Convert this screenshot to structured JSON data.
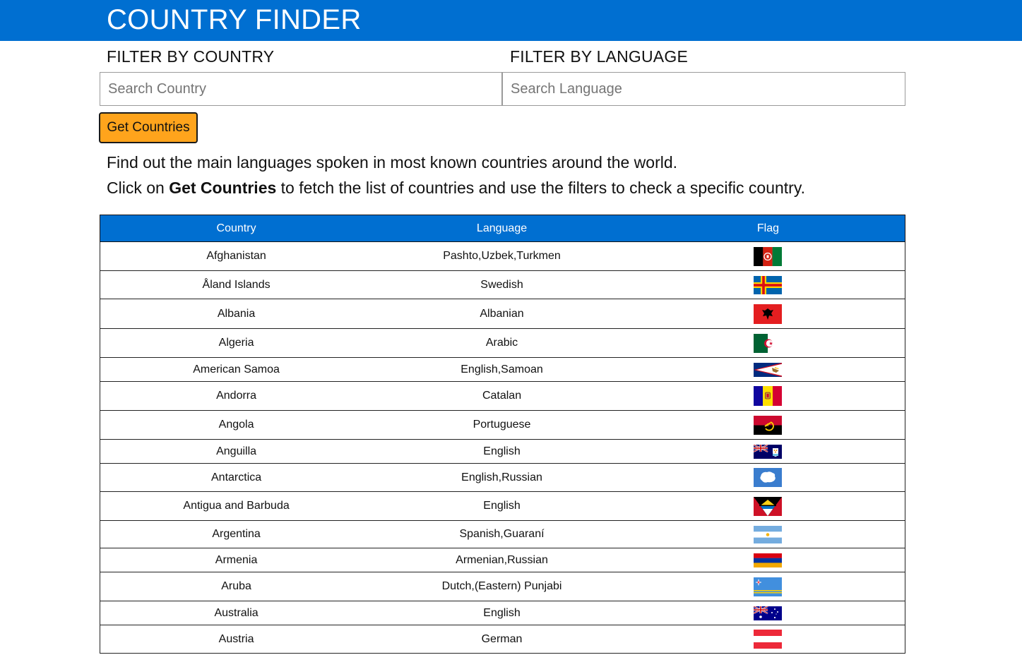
{
  "header": {
    "title": "COUNTRY FINDER"
  },
  "filters": {
    "country_label": "FILTER BY COUNTRY",
    "country_placeholder": "Search Country",
    "country_value": "",
    "language_label": "FILTER BY LANGUAGE",
    "language_placeholder": "Search Language",
    "language_value": ""
  },
  "get_button_label": "Get Countries",
  "intro": {
    "line1": "Find out the main languages spoken in most known countries around the world.",
    "line2_prefix": "Click on ",
    "line2_bold": "Get Countries",
    "line2_suffix": " to fetch the list of countries and use the filters to check a specific country."
  },
  "table": {
    "columns": [
      "Country",
      "Language",
      "Flag"
    ],
    "rows": [
      {
        "country": "Afghanistan",
        "language": "Pashto,Uzbek,Turkmen",
        "flag": "flag-afghanistan-icon"
      },
      {
        "country": "Åland Islands",
        "language": "Swedish",
        "flag": "flag-aland-icon"
      },
      {
        "country": "Albania",
        "language": "Albanian",
        "flag": "flag-albania-icon"
      },
      {
        "country": "Algeria",
        "language": "Arabic",
        "flag": "flag-algeria-icon"
      },
      {
        "country": "American Samoa",
        "language": "English,Samoan",
        "flag": "flag-american-samoa-icon"
      },
      {
        "country": "Andorra",
        "language": "Catalan",
        "flag": "flag-andorra-icon"
      },
      {
        "country": "Angola",
        "language": "Portuguese",
        "flag": "flag-angola-icon"
      },
      {
        "country": "Anguilla",
        "language": "English",
        "flag": "flag-anguilla-icon"
      },
      {
        "country": "Antarctica",
        "language": "English,Russian",
        "flag": "flag-antarctica-icon"
      },
      {
        "country": "Antigua and Barbuda",
        "language": "English",
        "flag": "flag-antigua-icon"
      },
      {
        "country": "Argentina",
        "language": "Spanish,Guaraní",
        "flag": "flag-argentina-icon"
      },
      {
        "country": "Armenia",
        "language": "Armenian,Russian",
        "flag": "flag-armenia-icon"
      },
      {
        "country": "Aruba",
        "language": "Dutch,(Eastern) Punjabi",
        "flag": "flag-aruba-icon"
      },
      {
        "country": "Australia",
        "language": "English",
        "flag": "flag-australia-icon"
      },
      {
        "country": "Austria",
        "language": "German",
        "flag": "flag-austria-icon"
      }
    ]
  }
}
